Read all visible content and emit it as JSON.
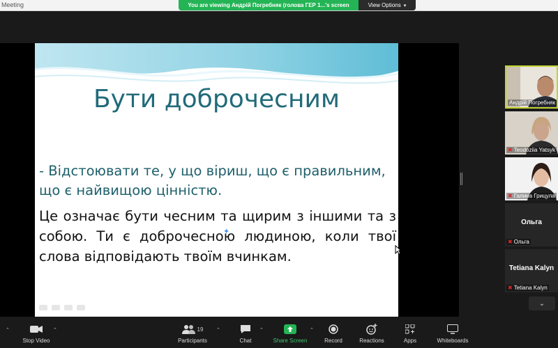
{
  "window": {
    "title": "Meeting"
  },
  "banner": {
    "message": "You are viewing Андрій Погребняк (голова ГЕР 1...'s screen",
    "view_options": "View Options"
  },
  "slide": {
    "title": "Бути доброчесним",
    "bullet": "- Відстоювати те, у що віриш, що є правильним, що є найвищою цінністю.",
    "body": "Це означає бути чесним та щирим з іншими та з собою. Ти є доброчесною людиною, коли твої слова відповідають твоїм вчинкам."
  },
  "gallery": {
    "participants": [
      {
        "name": "Андрій Погребняк",
        "active": true,
        "muted": false
      },
      {
        "name": "Teodoziia Yatsyk",
        "active": false,
        "muted": true
      },
      {
        "name": "Галина Грицула",
        "active": false,
        "muted": true
      },
      {
        "name": "Ольга",
        "display_name": "Ольга",
        "active": false,
        "muted": true
      },
      {
        "name": "Tetiana Kalyn",
        "display_name": "Tetiana Kalyn",
        "active": false,
        "muted": true
      }
    ]
  },
  "toolbar": {
    "stop_video": "Stop Video",
    "participants": "Participants",
    "participant_count": "19",
    "chat": "Chat",
    "share_screen": "Share Screen",
    "record": "Record",
    "reactions": "Reactions",
    "apps": "Apps",
    "whiteboards": "Whiteboards"
  },
  "colors": {
    "banner_green": "#24b455",
    "slide_title": "#216b7a",
    "active_border": "#c3d431",
    "share_green": "#3ec46d",
    "muted_red": "#e02828"
  },
  "icons": [
    "video-camera-icon",
    "participants-icon",
    "chat-icon",
    "share-screen-icon",
    "record-icon",
    "reactions-icon",
    "apps-icon",
    "whiteboards-icon",
    "mic-muted-icon",
    "chevron-down-icon"
  ]
}
